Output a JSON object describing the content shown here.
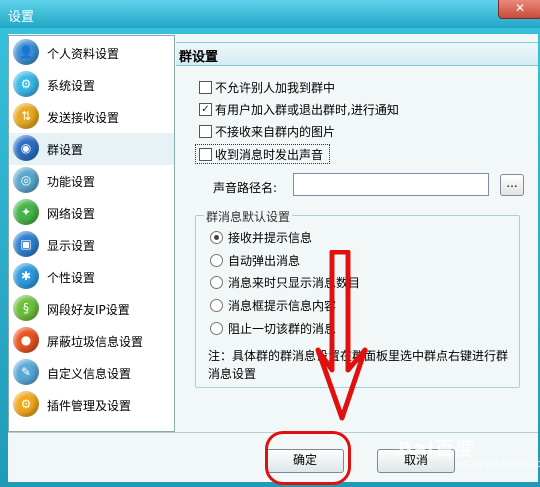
{
  "window": {
    "title": "设置",
    "close_glyph": "✕"
  },
  "sidebar": {
    "items": [
      {
        "label": "个人资料设置",
        "icon": "profile-icon",
        "color": "#3c8fd6",
        "glyph": "👤"
      },
      {
        "label": "系统设置",
        "icon": "system-icon",
        "color": "#3ab7e6",
        "glyph": "⚙"
      },
      {
        "label": "发送接收设置",
        "icon": "send-receive-icon",
        "color": "#e7a81c",
        "glyph": "⇅"
      },
      {
        "label": "群设置",
        "icon": "group-icon",
        "color": "#2b6fc4",
        "glyph": "◉"
      },
      {
        "label": "功能设置",
        "icon": "function-icon",
        "color": "#5aa7cc",
        "glyph": "◎"
      },
      {
        "label": "网络设置",
        "icon": "network-icon",
        "color": "#46b449",
        "glyph": "✦"
      },
      {
        "label": "显示设置",
        "icon": "display-icon",
        "color": "#2f7ed1",
        "glyph": "▣"
      },
      {
        "label": "个性设置",
        "icon": "personalize-icon",
        "color": "#2c9ae0",
        "glyph": "✱"
      },
      {
        "label": "网段好友IP设置",
        "icon": "ip-icon",
        "color": "#6fbf3e",
        "glyph": "§"
      },
      {
        "label": "屏蔽垃圾信息设置",
        "icon": "block-spam-icon",
        "color": "#e8531f",
        "glyph": "●"
      },
      {
        "label": "自定义信息设置",
        "icon": "custom-info-icon",
        "color": "#58a8d8",
        "glyph": "✎"
      },
      {
        "label": "插件管理及设置",
        "icon": "plugin-icon",
        "color": "#f0a81a",
        "glyph": "⚙"
      }
    ],
    "selected": "群设置"
  },
  "panel": {
    "header": "群设置",
    "options": [
      {
        "label": "不允许别人加我到群中",
        "checked": false
      },
      {
        "label": "有用户加入群或退出群时,进行通知",
        "checked": true
      },
      {
        "label": "不接收来自群内的图片",
        "checked": false
      },
      {
        "label": "收到消息时发出声音",
        "checked": false
      }
    ],
    "check_glyph": "✓",
    "sound_path": {
      "label": "声音路径名:",
      "value": "",
      "browse_label": "..."
    },
    "group_defaults": {
      "title": "群消息默认设置",
      "options": [
        {
          "label": "接收并提示信息",
          "selected": true
        },
        {
          "label": "自动弹出消息",
          "selected": false
        },
        {
          "label": "消息来时只显示消息数目",
          "selected": false
        },
        {
          "label": "消息框提示信息内容",
          "selected": false
        },
        {
          "label": "阻止一切该群的消息",
          "selected": false
        }
      ],
      "note": "注：具体群的群消息设置在群面板里选中群点右键进行群消息设置"
    }
  },
  "buttons": {
    "ok": "确定",
    "cancel": "取消"
  },
  "annotation": {
    "color": "#e01010"
  },
  "watermark": {
    "brand": "Bai百度",
    "sub": "jingyan.baidu.com"
  }
}
